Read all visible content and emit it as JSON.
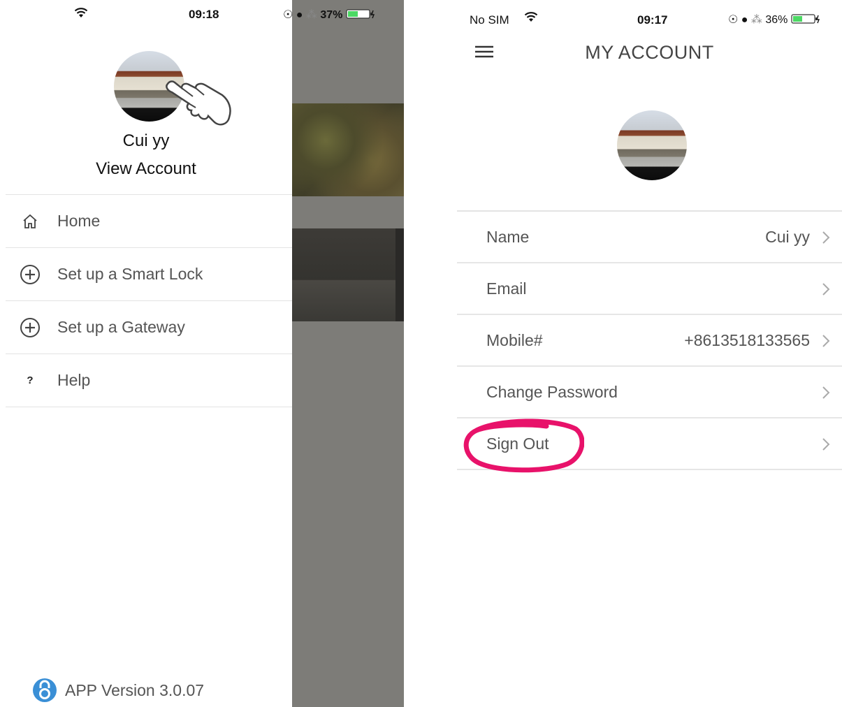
{
  "left": {
    "status": {
      "time": "09:18",
      "right": "37%"
    },
    "profile": {
      "name": "Cui yy",
      "view_account": "View Account"
    },
    "menu": [
      {
        "label": "Home",
        "icon": "home-icon"
      },
      {
        "label": "Set up a Smart Lock",
        "icon": "plus-circle-icon"
      },
      {
        "label": "Set up a Gateway",
        "icon": "plus-circle-icon"
      },
      {
        "label": "Help",
        "icon": "question-icon",
        "glyph": "?"
      }
    ],
    "version": "APP Version 3.0.07"
  },
  "right": {
    "status": {
      "carrier": "No SIM",
      "time": "09:17",
      "right": "36%"
    },
    "title": "MY ACCOUNT",
    "rows": [
      {
        "label": "Name",
        "value": "Cui yy"
      },
      {
        "label": "Email",
        "value": ""
      },
      {
        "label": "Mobile#",
        "value": "+8613518133565"
      },
      {
        "label": "Change Password",
        "value": ""
      },
      {
        "label": "Sign Out",
        "value": ""
      }
    ]
  },
  "colors": {
    "highlight": "#e8126a",
    "battery": "#4cd964",
    "overlay": "#7d7c78",
    "logo": "#3a8fd6"
  }
}
